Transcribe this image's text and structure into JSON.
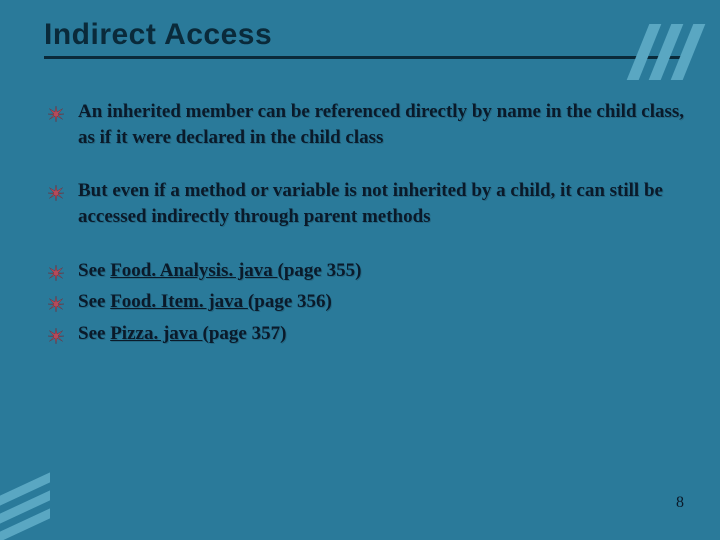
{
  "title": "Indirect Access",
  "bullets": [
    {
      "text": "An inherited member can be referenced directly by name in the child class, as if it were declared in the child class",
      "tight": false
    },
    {
      "text": "But even if a method or variable is not inherited by a child, it can still be accessed indirectly through parent methods",
      "tight": false
    },
    {
      "prefix": "See ",
      "link": "Food. Analysis. java ",
      "suffix": "(page 355)",
      "tight": true
    },
    {
      "prefix": "See ",
      "link": "Food. Item. java ",
      "suffix": "(page 356)",
      "tight": true
    },
    {
      "prefix": "See ",
      "link": "Pizza. java ",
      "suffix": "(page 357)",
      "tight": false
    }
  ],
  "page_number": "8",
  "colors": {
    "bg": "#2a7a9a",
    "title": "#0a2a3a",
    "body": "#0a1a2a",
    "accent": "#5aa7c2",
    "bullet_fill": "#b54a5a"
  }
}
